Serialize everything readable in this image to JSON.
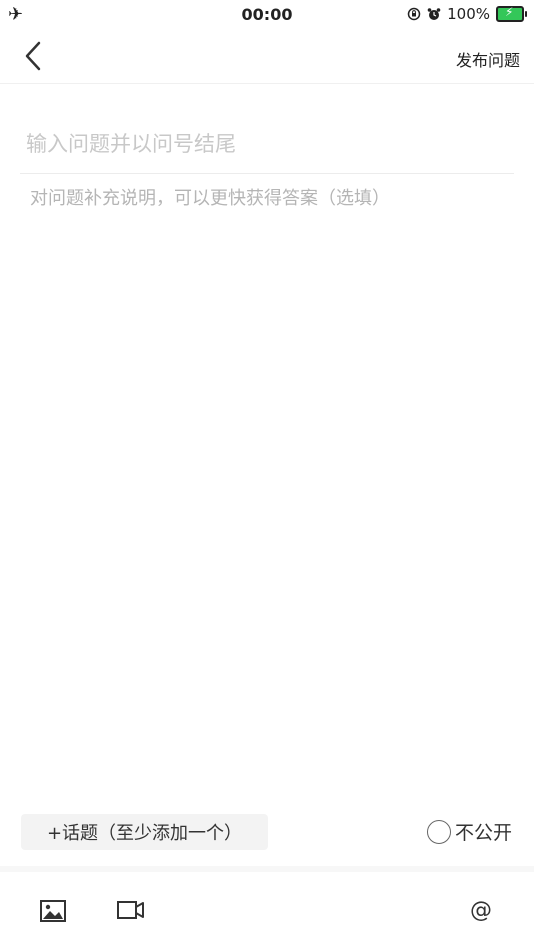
{
  "status_bar": {
    "airplane_icon": "✈",
    "time": "00:00",
    "battery_percent": "100%",
    "battery_color": "#34c759"
  },
  "nav": {
    "publish_label": "发布问题"
  },
  "form": {
    "title_placeholder": "输入问题并以问号结尾",
    "desc_placeholder": "对问题补充说明，可以更快获得答案（选填）"
  },
  "options": {
    "topic_label": "+话题（至少添加一个）",
    "private_label": "不公开"
  },
  "toolbar": {
    "image_icon": "image-icon",
    "video_icon": "video-icon",
    "at_label": "@"
  }
}
